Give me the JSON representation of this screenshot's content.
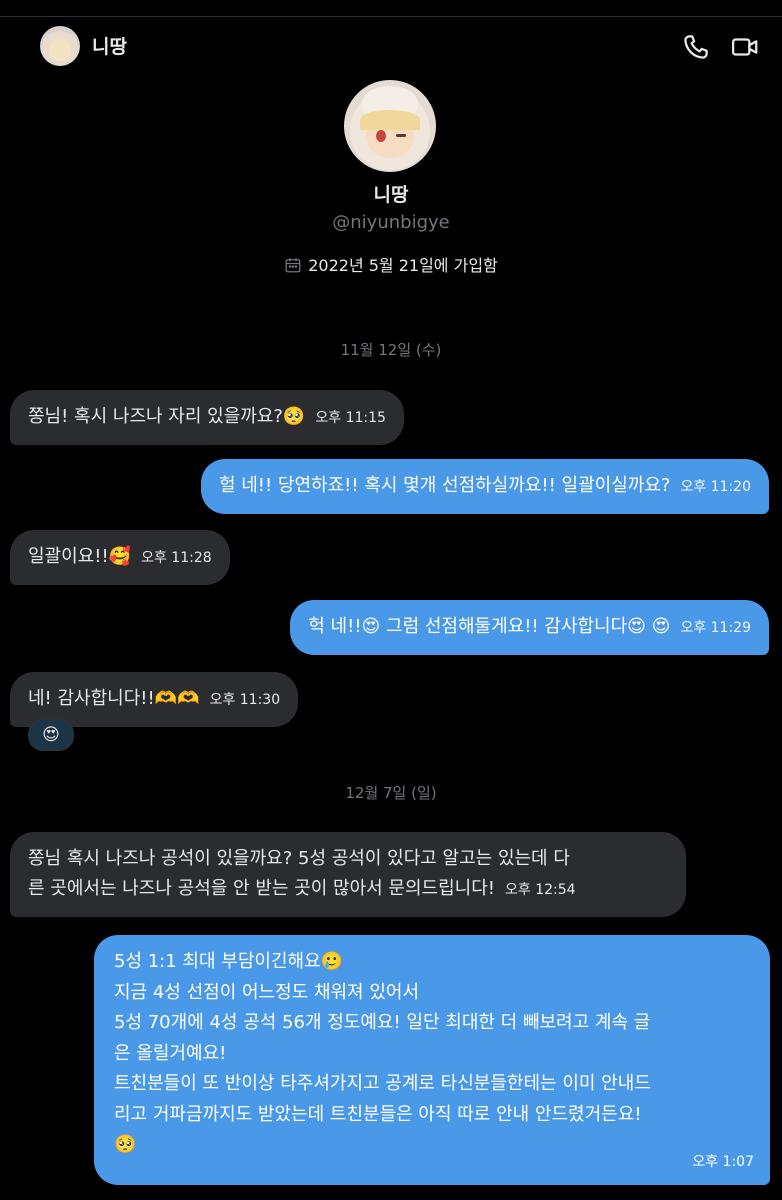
{
  "header": {
    "name": "니땅",
    "avatar_icon": "avatar-icon",
    "phone_icon": "phone-icon",
    "video_icon": "video-icon"
  },
  "profile": {
    "name": "니땅",
    "handle": "@niyunbigye",
    "joined": "2022년 5월 21일에 가입함"
  },
  "dates": [
    "11월 12일 (수)",
    "12월 7일 (일)"
  ],
  "messages": [
    {
      "dir": "in",
      "text": "쫑님! 혹시 나즈나 자리 있을까요?🥺",
      "time": "오후 11:15"
    },
    {
      "dir": "out",
      "text": "헐 네!! 당연하죠!! 혹시 몇개 선점하실까요!! 일괄이실까요?",
      "time": "오후 11:20"
    },
    {
      "dir": "in",
      "text": "일괄이요!!🥰",
      "time": "오후 11:28"
    },
    {
      "dir": "out",
      "text": "헉 네!!😍 그럼 선점해둘게요!! 감사합니다😍 😍",
      "time": "오후 11:29"
    },
    {
      "dir": "in",
      "text": "네! 감사합니다!!🫶🫶",
      "time": "오후 11:30",
      "reaction": "😍"
    },
    {
      "dir": "in",
      "line1": "쫑님 혹시 나즈나 공석이 있을까요? 5성 공석이 있다고 알고는 있는데 다",
      "line2": "른 곳에서는 나즈나 공석을 안 받는 곳이 많아서 문의드립니다!",
      "time": "오후 12:54"
    },
    {
      "dir": "out",
      "lines": [
        "5성 1:1 최대 부담이긴해요🥲",
        "지금 4성 선점이 어느정도 채워져 있어서",
        "5성 70개에 4성 공석 56개 정도예요! 일단 최대한 더 빼보려고 계속 글",
        "은 올릴거예요!",
        "트친분들이 또 반이상 타주셔가지고 공계로 타신분들한테는 이미 안내드",
        "리고 거파금까지도 받았는데 트친분들은 아직 따로 안내 안드렸거든요!",
        "🥺"
      ],
      "time": "오후 1:07"
    }
  ]
}
